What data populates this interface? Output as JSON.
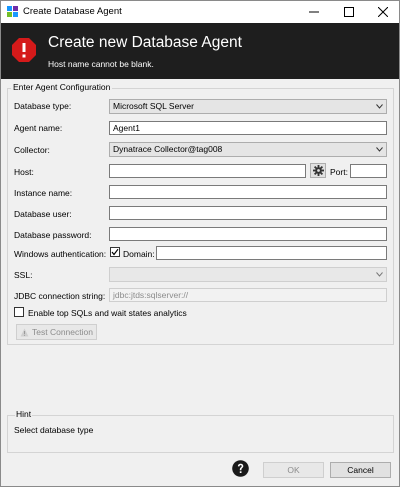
{
  "window": {
    "title": "Create Database Agent"
  },
  "banner": {
    "title": "Create new Database Agent",
    "message": "Host name cannot be blank."
  },
  "form": {
    "group_title": "Enter Agent Configuration",
    "database_type": {
      "label": "Database type:",
      "value": "Microsoft SQL Server"
    },
    "agent_name": {
      "label": "Agent name:",
      "value": "Agent1"
    },
    "collector": {
      "label": "Collector:",
      "value": "Dynatrace Collector@tag008"
    },
    "host": {
      "label": "Host:",
      "value": ""
    },
    "port": {
      "label": "Port:",
      "value": ""
    },
    "instance_name": {
      "label": "Instance name:",
      "value": ""
    },
    "database_user": {
      "label": "Database user:",
      "value": ""
    },
    "database_password": {
      "label": "Database password:",
      "value": ""
    },
    "windows_auth": {
      "label": "Windows authentication:",
      "checked": true
    },
    "domain": {
      "label": "Domain:",
      "value": ""
    },
    "ssl": {
      "label": "SSL:",
      "value": ""
    },
    "jdbc": {
      "label": "JDBC connection string:",
      "value": "jdbc:jtds:sqlserver://"
    },
    "enable_top_sqls": {
      "label": "Enable top SQLs and wait states analytics",
      "checked": false
    },
    "test_connection": "Test Connection"
  },
  "hint": {
    "title": "Hint",
    "text": "Select database type"
  },
  "buttons": {
    "ok": "OK",
    "cancel": "Cancel"
  },
  "icons": {
    "app": "dynatrace-logo-icon",
    "error": "error-octagon-icon",
    "help": "help-circle-icon",
    "gear": "gear-icon",
    "test": "warning-icon"
  },
  "colors": {
    "banner_bg": "#1e1e1e",
    "error_red": "#d51a1a"
  }
}
